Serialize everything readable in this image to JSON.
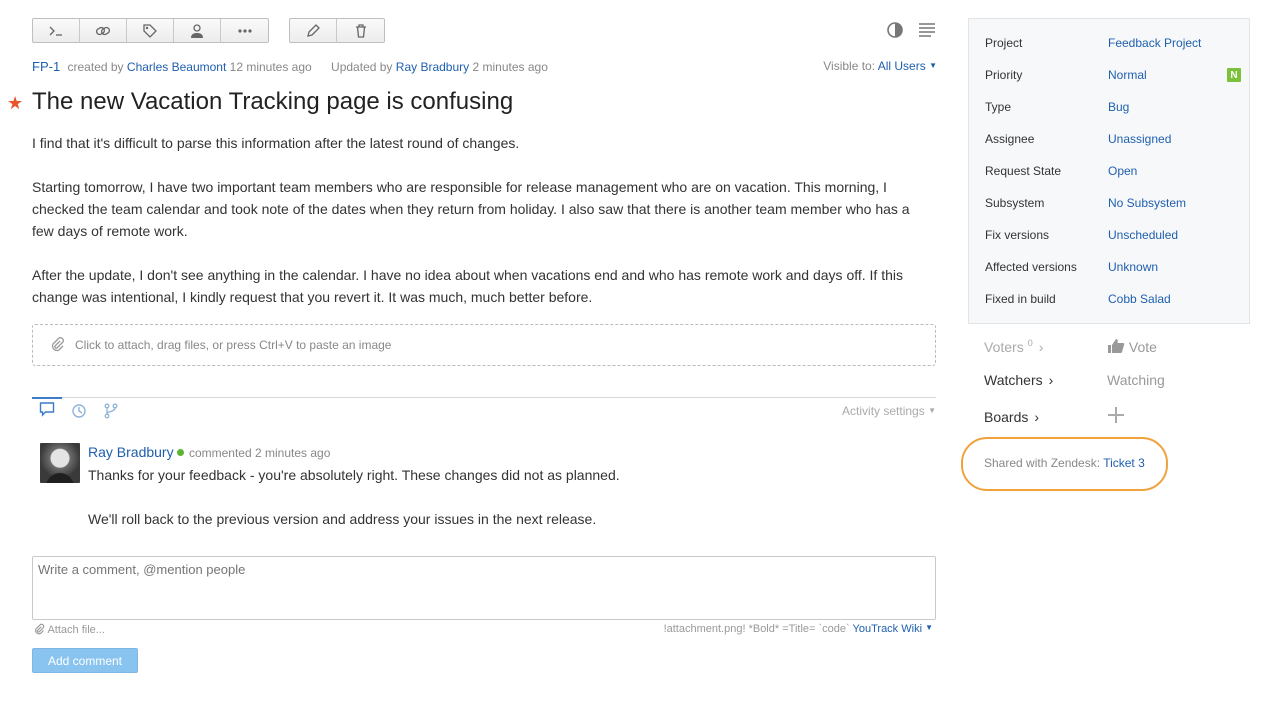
{
  "toolbar": {
    "group1": [
      {
        "name": "command-icon"
      },
      {
        "name": "link-icon"
      },
      {
        "name": "tag-icon"
      },
      {
        "name": "user-icon"
      },
      {
        "name": "more-icon"
      }
    ],
    "group2": [
      {
        "name": "edit-icon"
      },
      {
        "name": "delete-icon"
      }
    ]
  },
  "issue": {
    "id": "FP-1",
    "created_by_prefix": "created by",
    "creator": "Charles Beaumont",
    "created_ago": "12 minutes ago",
    "updated_by_prefix": "Updated by",
    "updater": "Ray Bradbury",
    "updated_ago": "2 minutes ago",
    "visible_prefix": "Visible to:",
    "visible_value": "All Users",
    "title": "The new Vacation Tracking page is confusing",
    "description": [
      "I find that it's difficult to parse this information after the latest round of changes.",
      "Starting tomorrow, I have two important team members who are responsible for release management who are on vacation. This morning, I checked the team calendar and took note of the dates when they return from holiday. I also saw that there is another team member who has a few days of remote work.",
      "After the update, I don't see anything in the calendar. I have no idea about when vacations end and who has remote work and days off. If this change was intentional, I kindly request that you revert it. It was much, much better before."
    ],
    "attach_hint": "Click to attach, drag files, or press Ctrl+V to paste an image"
  },
  "activity": {
    "settings_label": "Activity settings"
  },
  "comment": {
    "author": "Ray Bradbury",
    "action": "commented",
    "ago": "2 minutes ago",
    "lines": [
      "Thanks for your feedback - you're absolutely right. These changes did not as planned.",
      "We'll roll back to the previous version and address your issues in the next release."
    ]
  },
  "composer": {
    "placeholder": "Write a comment, @mention people",
    "attach_label": "Attach file...",
    "wiki_hint": "!attachment.png! *Bold* =Title= `code`",
    "wiki_link": "YouTrack Wiki",
    "submit_label": "Add comment"
  },
  "fields": [
    {
      "name": "Project",
      "value": "Feedback Project"
    },
    {
      "name": "Priority",
      "value": "Normal",
      "badge": "N"
    },
    {
      "name": "Type",
      "value": "Bug"
    },
    {
      "name": "Assignee",
      "value": "Unassigned"
    },
    {
      "name": "Request State",
      "value": "Open"
    },
    {
      "name": "Subsystem",
      "value": "No Subsystem"
    },
    {
      "name": "Fix versions",
      "value": "Unscheduled"
    },
    {
      "name": "Affected versions",
      "value": "Unknown"
    },
    {
      "name": "Fixed in build",
      "value": "Cobb Salad"
    }
  ],
  "sidebar": {
    "voters_label": "Voters",
    "voters_count": "0",
    "vote_label": "Vote",
    "watchers_label": "Watchers",
    "watching_label": "Watching",
    "boards_label": "Boards",
    "zendesk_label": "Shared with Zendesk:",
    "zendesk_ticket": "Ticket 3"
  },
  "colors": {
    "accent": "#1f5fae",
    "star": "#e8552d",
    "highlight": "#f0a23c",
    "badge": "#7cc13a"
  }
}
